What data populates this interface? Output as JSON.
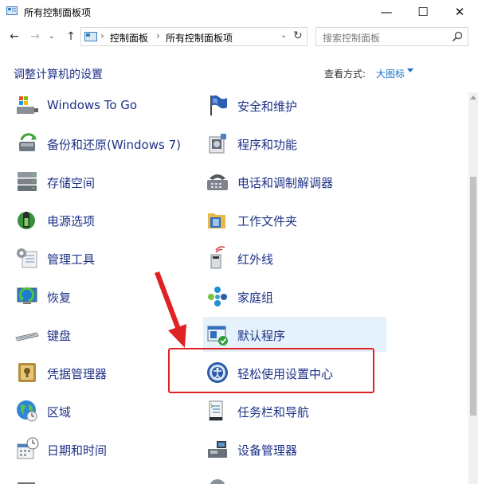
{
  "window": {
    "title": "所有控制面板项",
    "controls": {
      "minimize": "—",
      "maximize": "☐",
      "close": "✕"
    }
  },
  "nav": {
    "back": "←",
    "forward": "→",
    "recent": "⌄",
    "up": "↑",
    "breadcrumb": [
      "控制面板",
      "所有控制面板项"
    ],
    "separator": "›",
    "refresh": "↻",
    "search_placeholder": "搜索控制面板"
  },
  "header": {
    "title": "调整计算机的设置",
    "view_by_label": "查看方式:",
    "view_mode": "大图标"
  },
  "items_left": [
    {
      "label": "Windows To Go",
      "icon": "usb-drive-icon"
    },
    {
      "label": "备份和还原(Windows 7)",
      "icon": "backup-restore-icon"
    },
    {
      "label": "存储空间",
      "icon": "storage-spaces-icon"
    },
    {
      "label": "电源选项",
      "icon": "power-options-icon"
    },
    {
      "label": "管理工具",
      "icon": "admin-tools-icon"
    },
    {
      "label": "恢复",
      "icon": "recovery-icon"
    },
    {
      "label": "键盘",
      "icon": "keyboard-icon"
    },
    {
      "label": "凭据管理器",
      "icon": "credential-manager-icon"
    },
    {
      "label": "区域",
      "icon": "region-icon"
    },
    {
      "label": "日期和时间",
      "icon": "date-time-icon"
    }
  ],
  "items_right": [
    {
      "label": "安全和维护",
      "icon": "security-flag-icon"
    },
    {
      "label": "程序和功能",
      "icon": "programs-features-icon"
    },
    {
      "label": "电话和调制解调器",
      "icon": "phone-modem-icon"
    },
    {
      "label": "工作文件夹",
      "icon": "work-folders-icon"
    },
    {
      "label": "红外线",
      "icon": "infrared-icon"
    },
    {
      "label": "家庭组",
      "icon": "homegroup-icon"
    },
    {
      "label": "默认程序",
      "icon": "default-programs-icon"
    },
    {
      "label": "轻松使用设置中心",
      "icon": "ease-of-access-icon"
    },
    {
      "label": "任务栏和导航",
      "icon": "taskbar-navigation-icon"
    },
    {
      "label": "设备管理器",
      "icon": "device-manager-icon"
    }
  ],
  "colors": {
    "link": "#1e3287",
    "accent": "#1e6fc8",
    "hover": "#e5f1fb",
    "annotation": "#e02222"
  }
}
